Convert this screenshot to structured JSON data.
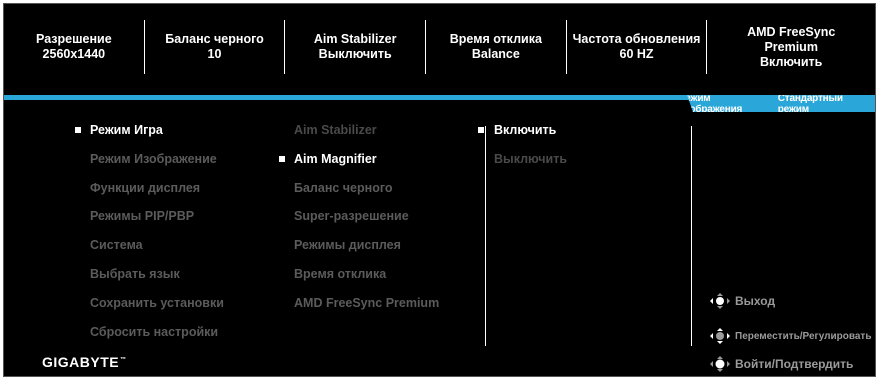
{
  "status_bar": [
    {
      "label": "Разрешение",
      "value": "2560x1440"
    },
    {
      "label": "Баланс черного",
      "value": "10"
    },
    {
      "label": "Aim Stabilizer",
      "value": "Выключить"
    },
    {
      "label": "Время отклика",
      "value": "Balance"
    },
    {
      "label": "Частота обновления",
      "value": "60 HZ"
    },
    {
      "label": "AMD FreeSync Premium",
      "value": "Включить"
    }
  ],
  "mode_tab": {
    "label": "Режим изображения",
    "value": "Стандартный режим"
  },
  "main_menu": [
    "Режим Игра",
    "Режим Изображение",
    "Функции дисплея",
    "Режимы PIP/PBP",
    "Система",
    "Выбрать язык",
    "Сохранить установки",
    "Сбросить настройки"
  ],
  "sub_menu": [
    "Aim Stabilizer",
    "Aim Magnifier",
    "Баланс черного",
    "Super-разрешение",
    "Режимы дисплея",
    "Время отклика",
    "AMD FreeSync Premium"
  ],
  "options": [
    "Включить",
    "Выключить"
  ],
  "hints": {
    "exit": "Выход",
    "move": "Переместить/Регулировать",
    "enter": "Войти/Подтвердить"
  },
  "brand": "GIGABYTE",
  "colors": {
    "accent": "#2aa7d8",
    "background": "#000000",
    "active_text": "#ffffff",
    "inactive_text": "#5b5b5b"
  }
}
